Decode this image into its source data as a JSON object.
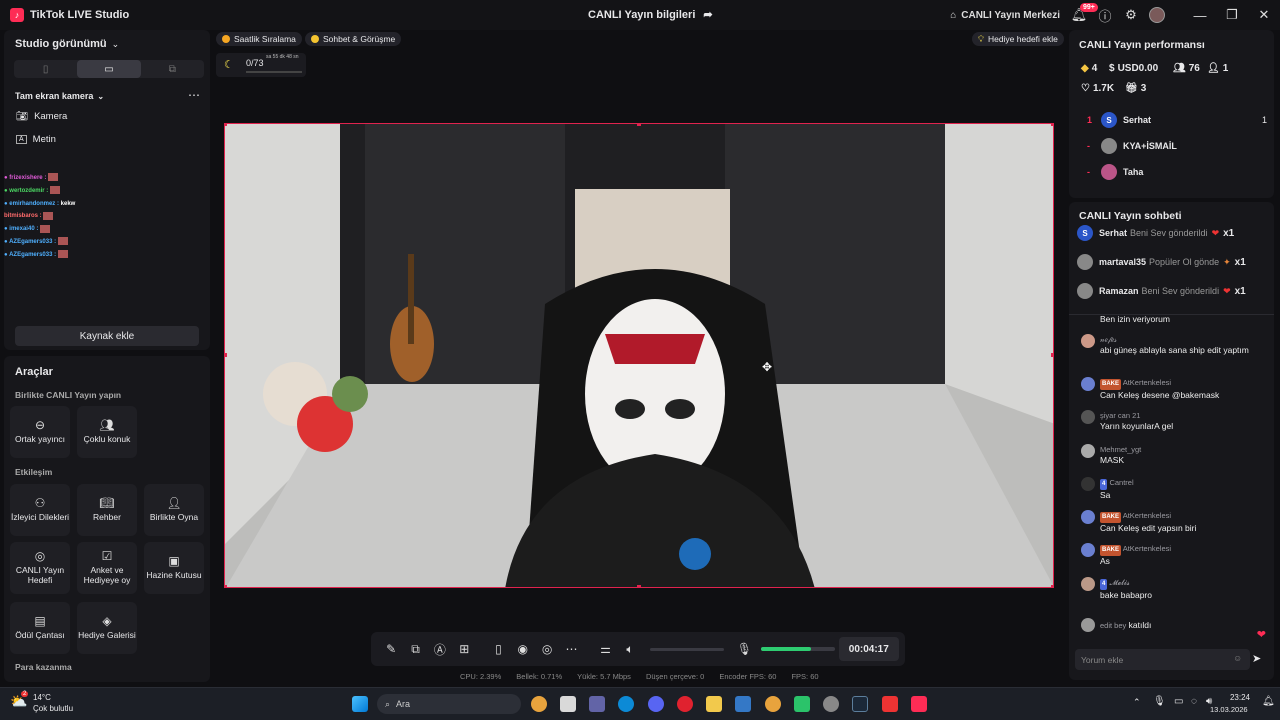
{
  "titlebar": {
    "app_name": "TikTok LIVE Studio",
    "center_title": "CANLI Yayın bilgileri",
    "live_center": "CANLI Yayın Merkezi",
    "notif_count": "99+"
  },
  "left": {
    "studio_view": "Studio görünümü",
    "scene": "Tam ekran kamera",
    "sources": [
      {
        "icon": "camera-icon",
        "label": "Kamera"
      },
      {
        "icon": "text-icon",
        "label": "Metin"
      }
    ],
    "overlay_chat": [
      {
        "user": "frizexishere :",
        "color": "#e05bd8"
      },
      {
        "user": "wertozdemir :",
        "color": "#4cd964"
      },
      {
        "user": "emirhandonmez :",
        "color": "#4fb0ff",
        "text": "kekw"
      },
      {
        "user": "bitmisbaros :",
        "color": "#ff6b6b"
      },
      {
        "user": "imexai40 :",
        "color": "#4fb0ff"
      },
      {
        "user": "AZEgamers033 :",
        "color": "#4fb0ff"
      },
      {
        "user": "AZEgamers033 :",
        "color": "#4fb0ff"
      }
    ],
    "add_source": "Kaynak ekle",
    "tools_title": "Araçlar",
    "collab_title": "Birlikte CANLI Yayın yapın",
    "collab_tools": [
      "Ortak yayıncı",
      "Çoklu konuk"
    ],
    "interaction_title": "Etkileşim",
    "interaction_tools": [
      "İzleyici Dilekleri",
      "Rehber",
      "Birlikte Oyna",
      "CANLI Yayın Hedefi",
      "Anket ve Hediyeye oy",
      "Hazine Kutusu",
      "Ödül Çantası",
      "Hediye Galerisi"
    ],
    "earn_title": "Para kazanma"
  },
  "top": {
    "hourly_rank": "Saatlik Sıralama",
    "chat_meet": "Sohbet & Görüşme",
    "gift_goal": "Hediye hedefi ekle",
    "goal_progress": "0/73",
    "goal_timer": "sa 55 dk 48 sn"
  },
  "controls": {
    "elapsed": "00:04:17",
    "volume_fraction": 0.0,
    "mic_fraction": 0.68
  },
  "stats": {
    "cpu": "CPU: 2.39%",
    "memory": "Bellek: 0.71%",
    "upload": "Yükle: 5.7 Mbps",
    "dropped": "Düşen çerçeve: 0",
    "encoder_fps": "Encoder FPS: 60",
    "fps": "FPS: 60"
  },
  "performance": {
    "title": "CANLI Yayın performansı",
    "diamonds": "4",
    "usd": "USD0.00",
    "viewers": "76",
    "followers": "1",
    "likes": "1.7K",
    "gifts": "3",
    "ranking": [
      {
        "rank": "1",
        "name": "Serhat",
        "score": "1"
      },
      {
        "rank": "-",
        "name": "KYA+İSMAİL",
        "score": ""
      },
      {
        "rank": "-",
        "name": "Taha",
        "score": ""
      }
    ]
  },
  "chat": {
    "title": "CANLI Yayın sohbeti",
    "gifts": [
      {
        "user": "Serhat",
        "action": "Beni Sev gönderildi",
        "count": "x1"
      },
      {
        "user": "martaval35",
        "action": "Popüler Ol gönde",
        "count": "x1"
      },
      {
        "user": "Ramazan",
        "action": "Beni Sev gönderildi",
        "count": "x1"
      }
    ],
    "partial": "Ben izin veriyorum",
    "messages": [
      {
        "user": "𝓃𝑒𝒻𝑒𝓈",
        "text": "abi güneş ablayla sana ship edit yaptım",
        "tag": ""
      },
      {
        "user": "AtKertenkelesi",
        "text": "Can Keleş desene @bakemask",
        "tag": "BAKE"
      },
      {
        "user": "şiyar can 21",
        "text": "Yarın koyunlarA gel",
        "tag": ""
      },
      {
        "user": "Mehmet_ygt",
        "text": "MASK",
        "tag": ""
      },
      {
        "user": "Cantrel",
        "text": "Sa",
        "tag": "4"
      },
      {
        "user": "AtKertenkelesi",
        "text": "Can Keleş edit yapsın biri",
        "tag": "BAKE"
      },
      {
        "user": "AtKertenkelesi",
        "text": "As",
        "tag": "BAKE"
      },
      {
        "user": "𝓜𝓮𝓵𝓲𝓼",
        "text": "bake babapro",
        "tag": "4"
      }
    ],
    "join_user": "edit bey",
    "join_text": "katıldı",
    "comment_placeholder": "Yorum ekle"
  },
  "taskbar": {
    "weather_temp": "14°C",
    "weather_desc": "Çok bulutlu",
    "weather_badge": "2",
    "search": "Ara",
    "time": "23:24",
    "date": "13.03.2026"
  }
}
